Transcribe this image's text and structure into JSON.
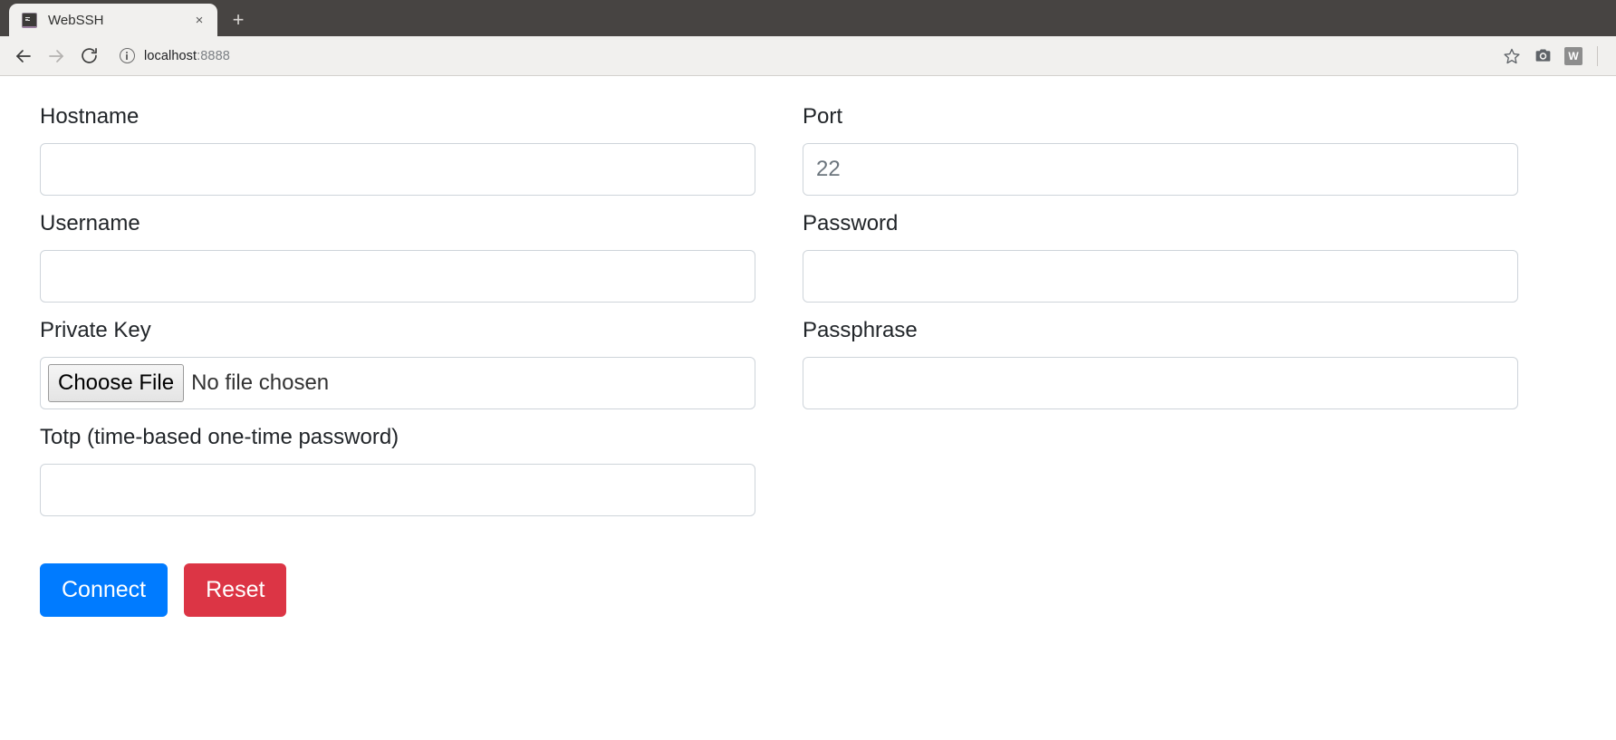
{
  "browser": {
    "tab": {
      "title": "WebSSH",
      "favicon": "terminal-icon",
      "close_label": "×"
    },
    "new_tab_label": "+",
    "nav": {
      "back": "back-arrow-icon",
      "forward": "forward-arrow-icon",
      "reload": "reload-icon"
    },
    "omnibox": {
      "security_icon": "info-circle-icon",
      "host": "localhost",
      "port": ":8888",
      "full_url": "localhost:8888"
    },
    "toolbar_actions": [
      {
        "name": "bookmark-star-icon",
        "label": ""
      },
      {
        "name": "screenshot-camera-icon",
        "label": ""
      },
      {
        "name": "extension-w-icon",
        "label": "W"
      }
    ]
  },
  "form": {
    "fields": {
      "hostname": {
        "label": "Hostname",
        "value": "",
        "placeholder": ""
      },
      "port": {
        "label": "Port",
        "value": "",
        "placeholder": "22"
      },
      "username": {
        "label": "Username",
        "value": "",
        "placeholder": ""
      },
      "password": {
        "label": "Password",
        "value": "",
        "placeholder": ""
      },
      "privatekey": {
        "label": "Private Key",
        "button_label": "Choose File",
        "file_status": "No file chosen"
      },
      "passphrase": {
        "label": "Passphrase",
        "value": "",
        "placeholder": ""
      },
      "totp": {
        "label": "Totp (time-based one-time password)",
        "value": "",
        "placeholder": ""
      }
    },
    "buttons": {
      "connect": "Connect",
      "reset": "Reset"
    }
  },
  "colors": {
    "primary": "#007bff",
    "danger": "#dc3545",
    "border": "#ced4da",
    "text": "#212529",
    "placeholder": "#6c757d",
    "tabstrip": "#474442",
    "toolbar": "#f1f0ee"
  }
}
